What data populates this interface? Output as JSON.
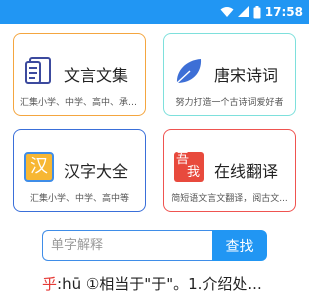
{
  "status_bar": {
    "time": "17:58",
    "icons": [
      "wifi-icon",
      "signal-icon",
      "battery-icon"
    ],
    "background": "#2196f3"
  },
  "cards": [
    {
      "title": "文言文集",
      "subtitle": "汇集小学、中学、高中、承传...",
      "icon": "document-icon",
      "border_color": "#f4a640"
    },
    {
      "title": "唐宋诗词",
      "subtitle": "努力打造一个古诗词爱好者",
      "icon": "leaf-icon",
      "border_color": "#7ee0dc"
    },
    {
      "title": "汉字大全",
      "subtitle": "汇集小学、中学、高中等",
      "icon": "han-character-icon",
      "icon_text": "汉",
      "border_color": "#3a6fd9"
    },
    {
      "title": "在线翻译",
      "subtitle": "简短语文言文翻译，阅古文...",
      "icon": "translate-stamp-icon",
      "icon_text_top": "吾",
      "icon_text_bottom": "我",
      "border_color": "#ef5350"
    }
  ],
  "search": {
    "placeholder": "单字解释",
    "value": "",
    "button_label": "查找"
  },
  "result": {
    "character": "乎",
    "definition": ":hū ①相当于\"于\"。1.介绍处..."
  }
}
